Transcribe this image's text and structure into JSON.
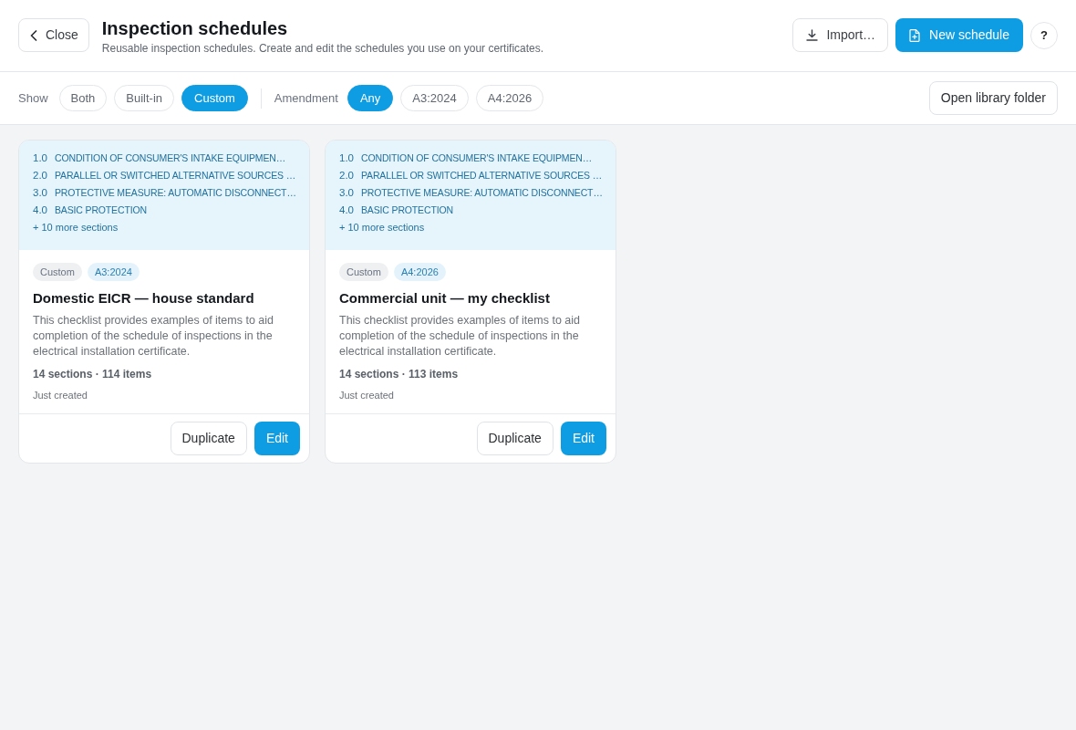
{
  "header": {
    "close_button": "Close",
    "title": "Inspection schedules",
    "subtitle": "Reusable inspection schedules. Create and edit the schedules you use on your certificates.",
    "import_button": "Import…",
    "new_button": "New schedule",
    "help_button": "?"
  },
  "filters": {
    "show_label": "Show",
    "show_options": [
      {
        "label": "Both",
        "selected": false
      },
      {
        "label": "Built-in",
        "selected": false
      },
      {
        "label": "Custom",
        "selected": true
      }
    ],
    "amendment_label": "Amendment",
    "amendment_options": [
      {
        "label": "Any",
        "selected": true
      },
      {
        "label": "A3:2024",
        "selected": false
      },
      {
        "label": "A4:2026",
        "selected": false
      }
    ],
    "library_button": "Open library folder"
  },
  "cards": [
    {
      "sections": [
        {
          "number": "1.0",
          "title": "CONDITION OF CONSUMER'S INTAKE EQUIPMEN…"
        },
        {
          "number": "2.0",
          "title": "PARALLEL OR SWITCHED ALTERNATIVE SOURCES …"
        },
        {
          "number": "3.0",
          "title": "PROTECTIVE MEASURE: AUTOMATIC DISCONNECT…"
        },
        {
          "number": "4.0",
          "title": "BASIC PROTECTION"
        }
      ],
      "more": "+ 10 more sections",
      "tags": [
        {
          "label": "Custom",
          "kind": "type"
        },
        {
          "label": "A3:2024",
          "kind": "amendment"
        }
      ],
      "title": "Domestic EICR — house standard",
      "description": "This checklist provides examples of items to aid completion of the schedule of inspections in the electrical installation certificate.",
      "stats": "14 sections · 114 items",
      "updated": "Just created",
      "buttons": [
        {
          "label": "Duplicate",
          "kind": "secondary"
        },
        {
          "label": "Edit",
          "kind": "primary"
        }
      ]
    },
    {
      "sections": [
        {
          "number": "1.0",
          "title": "CONDITION OF CONSUMER'S INTAKE EQUIPMEN…"
        },
        {
          "number": "2.0",
          "title": "PARALLEL OR SWITCHED ALTERNATIVE SOURCES …"
        },
        {
          "number": "3.0",
          "title": "PROTECTIVE MEASURE: AUTOMATIC DISCONNECT…"
        },
        {
          "number": "4.0",
          "title": "BASIC PROTECTION"
        }
      ],
      "more": "+ 10 more sections",
      "tags": [
        {
          "label": "Custom",
          "kind": "type"
        },
        {
          "label": "A4:2026",
          "kind": "amendment"
        }
      ],
      "title": "Commercial unit — my checklist",
      "description": "This checklist provides examples of items to aid completion of the schedule of inspections in the electrical installation certificate.",
      "stats": "14 sections · 113 items",
      "updated": "Just created",
      "buttons": [
        {
          "label": "Duplicate",
          "kind": "secondary"
        },
        {
          "label": "Edit",
          "kind": "primary"
        }
      ]
    }
  ]
}
